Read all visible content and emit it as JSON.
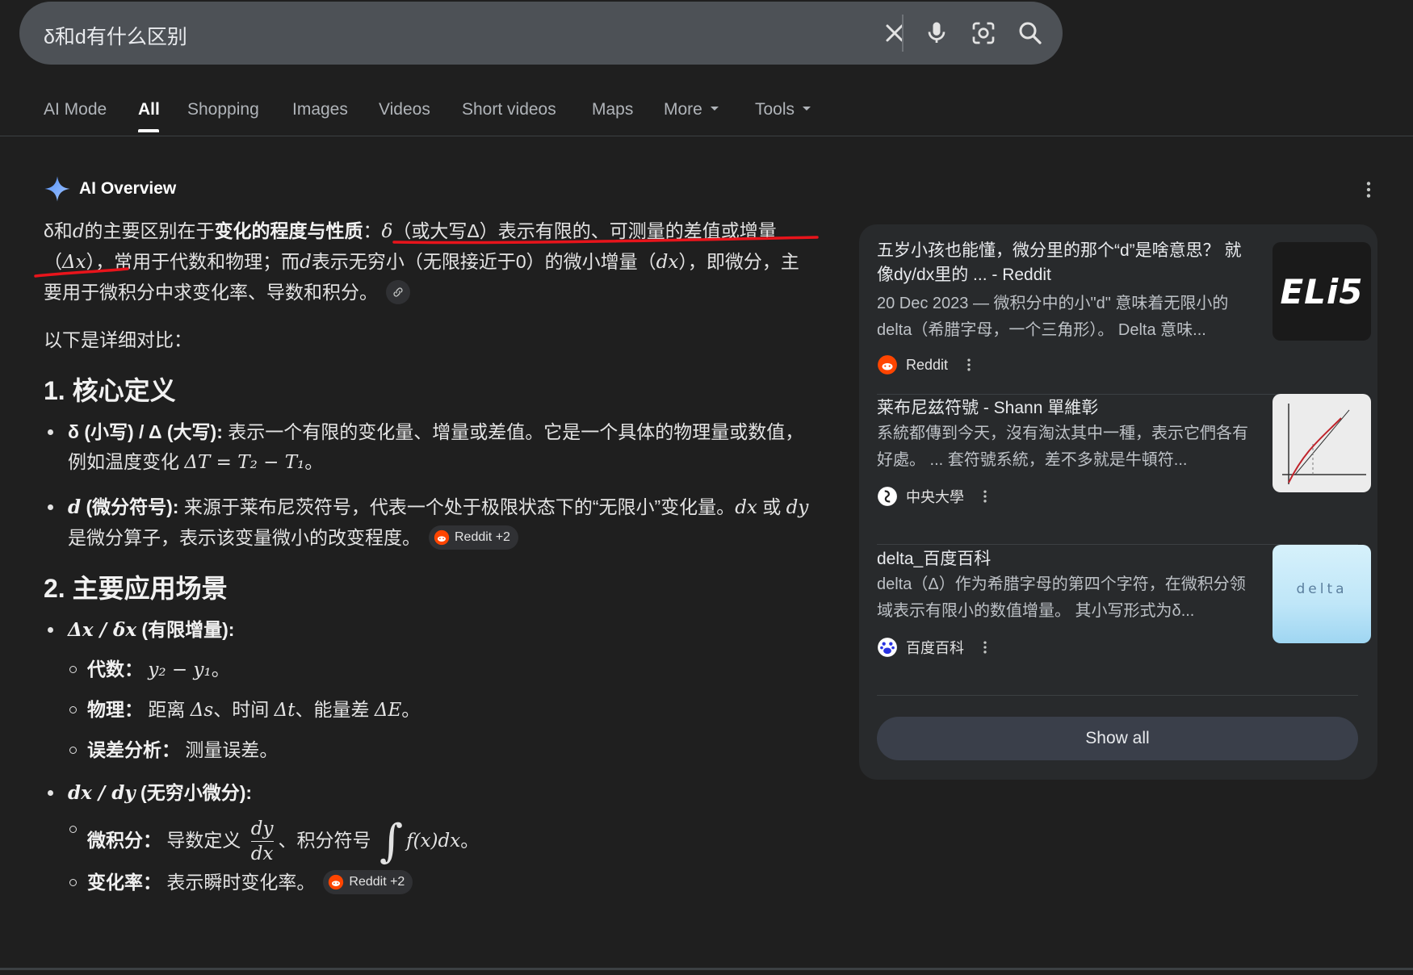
{
  "search": {
    "query": "δ和d有什么区别",
    "clear_icon": "close-icon",
    "voice_icon": "mic-icon",
    "lens_icon": "camera-lens-icon",
    "search_icon": "search-icon"
  },
  "tabs": [
    {
      "label": "AI Mode"
    },
    {
      "label": "All",
      "active": true
    },
    {
      "label": "Shopping"
    },
    {
      "label": "Images"
    },
    {
      "label": "Videos"
    },
    {
      "label": "Short videos"
    },
    {
      "label": "Maps"
    },
    {
      "label": "More"
    },
    {
      "label": "Tools"
    }
  ],
  "ai_overview": {
    "title": "AI Overview",
    "intro": {
      "p1a": "δ和",
      "p1b": "d",
      "p1c": "的主要区别在于",
      "p1d": "变化的程度与性质",
      "p1e": "：",
      "p1f": "δ",
      "p1g": "（或大写Δ）表示有限的、可测量的差值或增量（",
      "p1h": "Δx",
      "p1i": "），常用于代数和物理；而",
      "p1j": "d",
      "p1k": "表示无穷小（无限接近于0）的微小增量（",
      "p1l": "dx",
      "p1m": "），即微分，主要用于微积分中求变化率、导数和积分。"
    },
    "compare_intro": "以下是详细对比：",
    "section1": {
      "heading": "1. 核心定义",
      "item1_label": "δ (小写) / Δ (大写):",
      "item1_text": " 表示一个有限的变化量、增量或差值。它是一个具体的物理量或数值，例如温度变化 ",
      "item1_math": "ΔT = T₂ − T₁",
      "item1_end": "。",
      "item2_label_math": "d",
      "item2_label": " (微分符号):",
      "item2_text": " 来源于莱布尼茨符号，代表一个处于极限状态下的“无限小”变化量。",
      "item2_m1": "dx",
      "item2_or": " 或 ",
      "item2_m2": "dy",
      "item2_end": " 是微分算子，表示该变量微小的改变程度。",
      "chip": "Reddit +2"
    },
    "section2": {
      "heading": "2. 主要应用场景",
      "group1_math": "Δx / δx",
      "group1_label": " (有限增量):",
      "g1_a_label": "代数：",
      "g1_a_math": "y₂ − y₁",
      "g1_a_end": "。",
      "g1_b_label": "物理：",
      "g1_b_t1": "距离 ",
      "g1_b_m1": "Δs",
      "g1_b_t2": "、时间 ",
      "g1_b_m2": "Δt",
      "g1_b_t3": "、能量差 ",
      "g1_b_m3": "ΔE",
      "g1_b_end": "。",
      "g1_c_label": "误差分析：",
      "g1_c_text": "测量误差。",
      "group2_math": "dx / dy",
      "group2_label": " (无穷小微分):",
      "g2_a_label": "微积分：",
      "g2_a_t1": "导数定义 ",
      "g2_a_num": "dy",
      "g2_a_den": "dx",
      "g2_a_t2": "、积分符号 ",
      "g2_a_int": "∫",
      "g2_a_m": "f(x)dx",
      "g2_a_end": "。",
      "g2_b_label": "变化率：",
      "g2_b_text": "表示瞬时变化率。",
      "chip": "Reddit +2"
    }
  },
  "sources": [
    {
      "title": "五岁小孩也能懂，微分里的那个“d”是啥意思？ 就像dy/dx里的 ... - Reddit",
      "snippet": "20 Dec 2023 — 微积分中的小\"d\" 意味着无限小的delta（希腊字母，一个三角形）。 Delta 意味...",
      "source": "Reddit",
      "thumb_text": "ELi5"
    },
    {
      "title": "莱布尼兹符號 - Shann 單維彰",
      "snippet": "系統都傳到今天，沒有淘汰其中一種，表示它們各有好處。 ... 套符號系統，差不多就是牛頓符...",
      "source": "中央大學"
    },
    {
      "title": "delta_百度百科",
      "snippet": "delta（Δ）作为希腊字母的第四个字符，在微积分领域表示有限小的数值增量。 其小写形式为δ...",
      "source": "百度百科",
      "thumb_text": "delta"
    }
  ],
  "show_all": "Show all",
  "colors": {
    "background": "#1f1f1f",
    "search_bar": "#4d5156",
    "panel": "#282a2c",
    "annotation_red": "#e8141b"
  }
}
